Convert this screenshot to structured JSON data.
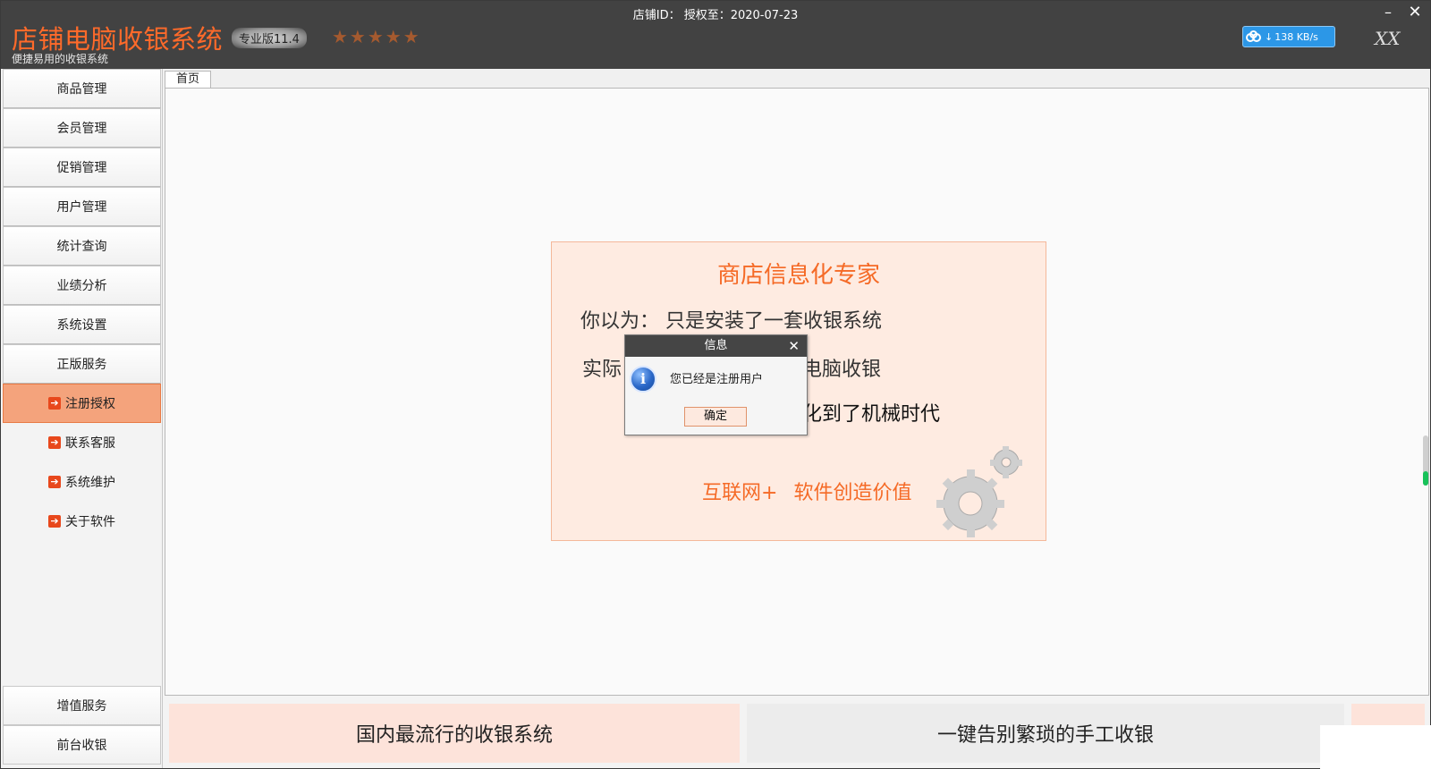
{
  "titlebar": {
    "app_title": "店铺电脑收银系统",
    "app_subtitle": "便捷易用的收银系统",
    "version": "专业版11.4",
    "stars": "★★★★★",
    "shop_info": "店铺ID： 授权至：2020-07-23",
    "speed": "138 KB/s",
    "user": "XX",
    "minimize": "–",
    "close": "✕"
  },
  "sidebar": {
    "items": [
      {
        "label": "商品管理"
      },
      {
        "label": "会员管理"
      },
      {
        "label": "促销管理"
      },
      {
        "label": "用户管理"
      },
      {
        "label": "统计查询"
      },
      {
        "label": "业绩分析"
      },
      {
        "label": "系统设置"
      },
      {
        "label": "正版服务"
      }
    ],
    "sub_items": [
      {
        "label": "注册授权"
      },
      {
        "label": "联系客服"
      },
      {
        "label": "系统维护"
      },
      {
        "label": "关于软件"
      }
    ],
    "bottom": [
      {
        "label": "增值服务"
      },
      {
        "label": "前台收银"
      }
    ]
  },
  "tabs": {
    "home": "首页"
  },
  "promo": {
    "heading": "商店信息化专家",
    "line1": "你以为：  只是安装了一套收银系统",
    "line2_left": "实际",
    "line2_right": "电脑收银",
    "line3": "化到了机械时代",
    "slogan_left": "互联网+",
    "slogan_right": "软件创造价值"
  },
  "dialog": {
    "title": "信息",
    "message": "您已经是注册用户",
    "ok": "确定"
  },
  "footer": {
    "banner1": "国内最流行的收银系统",
    "banner2": "一键告别繁琐的手工收银"
  }
}
